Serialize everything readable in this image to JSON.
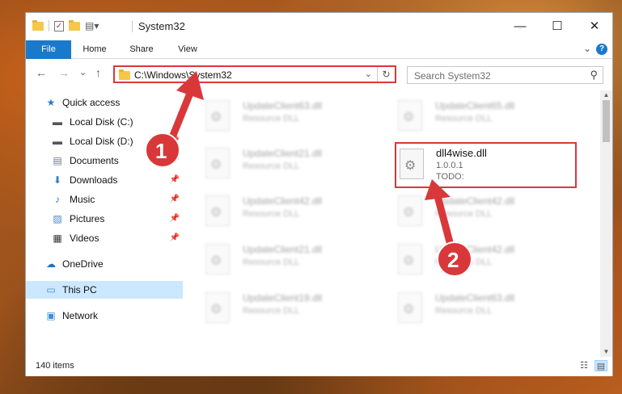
{
  "window": {
    "title": "System32",
    "controls": {
      "minimize": "—",
      "maximize": "☐",
      "close": "✕"
    }
  },
  "ribbon": {
    "tabs": [
      "File",
      "Home",
      "Share",
      "View"
    ],
    "collapse_glyph": "⌄",
    "help_glyph": "?"
  },
  "nav": {
    "back_glyph": "←",
    "forward_glyph": "→",
    "recent_glyph": "⌄",
    "up_glyph": "↑",
    "address": "C:\\Windows\\System32",
    "dropdown_glyph": "⌄",
    "refresh_glyph": "↻",
    "search_placeholder": "Search System32",
    "search_glyph": "⚲"
  },
  "sidebar": {
    "items": [
      {
        "label": "Quick access",
        "icon": "★",
        "icon_name": "star-icon",
        "color": "#2b7cd3"
      },
      {
        "label": "Local Disk (C:)",
        "icon": "▬",
        "icon_name": "drive-icon",
        "color": "#555555"
      },
      {
        "label": "Local Disk (D:)",
        "icon": "▬",
        "icon_name": "drive-icon",
        "color": "#555555"
      },
      {
        "label": "Documents",
        "icon": "▤",
        "icon_name": "documents-icon",
        "color": "#6b7a8c"
      },
      {
        "label": "Downloads",
        "icon": "⬇",
        "icon_name": "download-icon",
        "color": "#2b7cd3"
      },
      {
        "label": "Music",
        "icon": "♪",
        "icon_name": "music-icon",
        "color": "#2b7cd3"
      },
      {
        "label": "Pictures",
        "icon": "▨",
        "icon_name": "pictures-icon",
        "color": "#4a88c8"
      },
      {
        "label": "Videos",
        "icon": "▦",
        "icon_name": "video-icon",
        "color": "#333333"
      },
      {
        "label": "OneDrive",
        "icon": "☁",
        "icon_name": "cloud-icon",
        "color": "#1a73c9"
      },
      {
        "label": "This PC",
        "icon": "▭",
        "icon_name": "computer-icon",
        "color": "#3a8fd8"
      },
      {
        "label": "Network",
        "icon": "▣",
        "icon_name": "network-icon",
        "color": "#3a8fd8"
      }
    ],
    "pin_glyph": "📌"
  },
  "files": [
    {
      "name": "UpdateClient63.dll",
      "desc": "Resource DLL"
    },
    {
      "name": "UpdateClient65.dll",
      "desc": "Resource DLL"
    },
    {
      "name": "UpdateClient21.dll",
      "desc": "Resource DLL"
    },
    {
      "name": "UpdateClient42.dll",
      "desc": "Resource DLL"
    },
    {
      "name": "UpdateClient42.dll",
      "desc": "Resource DLL"
    },
    {
      "name": "UpdateClient21.dll",
      "desc": "Resource DLL"
    },
    {
      "name": "UpdateClient42.dll",
      "desc": "Resource DLL"
    },
    {
      "name": "UpdateClient19.dll",
      "desc": "Resource DLL"
    },
    {
      "name": "UpdateClient63.dll",
      "desc": "Resource DLL"
    }
  ],
  "highlighted_file": {
    "name": "dll4wise.dll",
    "version": "1.0.0.1",
    "description": "TODO:"
  },
  "status": {
    "item_count": "140 items"
  },
  "annotations": {
    "badge_1": "1",
    "badge_2": "2",
    "color": "#d9383a"
  }
}
